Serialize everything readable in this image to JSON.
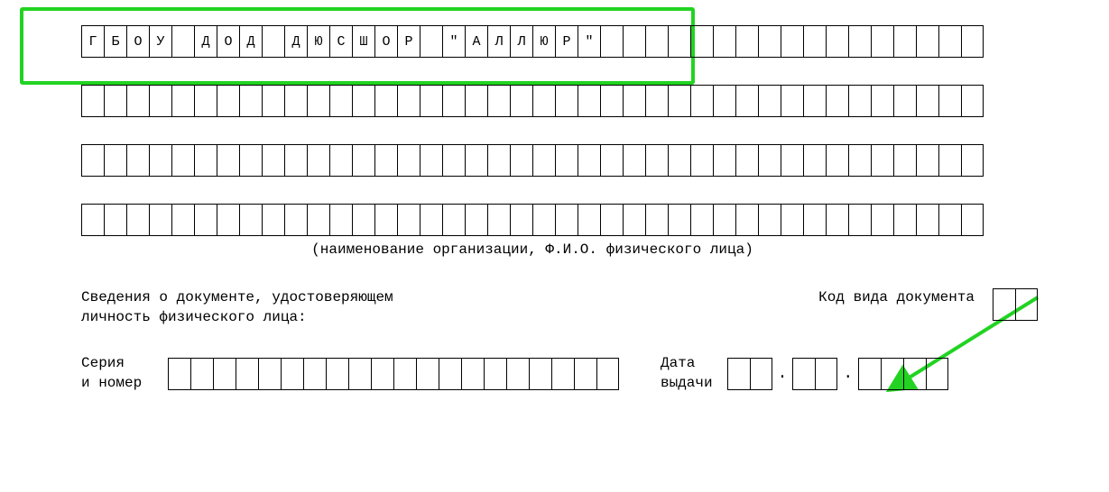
{
  "org_name_row1": [
    "Г",
    "Б",
    "О",
    "У",
    "",
    "Д",
    "О",
    "Д",
    "",
    "Д",
    "Ю",
    "С",
    "Ш",
    "О",
    "Р",
    "",
    "\"",
    "А",
    "Л",
    "Л",
    "Ю",
    "Р",
    "\"",
    "",
    "",
    "",
    "",
    "",
    "",
    "",
    "",
    "",
    "",
    "",
    "",
    "",
    "",
    "",
    "",
    ""
  ],
  "empty40": [
    "",
    "",
    "",
    "",
    "",
    "",
    "",
    "",
    "",
    "",
    "",
    "",
    "",
    "",
    "",
    "",
    "",
    "",
    "",
    "",
    "",
    "",
    "",
    "",
    "",
    "",
    "",
    "",
    "",
    "",
    "",
    "",
    "",
    "",
    "",
    "",
    "",
    "",
    "",
    ""
  ],
  "caption": "(наименование организации, Ф.И.О. физического лица)",
  "doc_label1": "Сведения о документе, удостоверяющем",
  "doc_label2": "личность физического лица:",
  "doc_code_label": "Код вида документа",
  "doc_code_cells": [
    "",
    ""
  ],
  "serial_label1": "Серия",
  "serial_label2": "и номер",
  "serial_cells": [
    "",
    "",
    "",
    "",
    "",
    "",
    "",
    "",
    "",
    "",
    "",
    "",
    "",
    "",
    "",
    "",
    "",
    "",
    "",
    ""
  ],
  "date_label1": "Дата",
  "date_label2": "выдачи",
  "date_d": [
    "",
    ""
  ],
  "date_m": [
    "",
    ""
  ],
  "date_y": [
    "",
    "",
    "",
    ""
  ],
  "date_sep": "."
}
